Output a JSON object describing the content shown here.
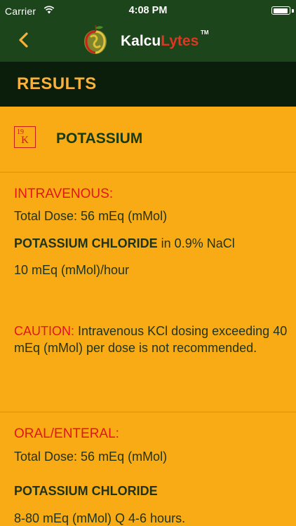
{
  "status_bar": {
    "carrier": "Carrier",
    "time": "4:08 PM"
  },
  "nav": {
    "back_icon": "chevron-left-icon",
    "logo_part1": "Kalcu",
    "logo_part2": "Lytes",
    "logo_tm": "TM"
  },
  "results": {
    "title": "RESULTS"
  },
  "element": {
    "number": "19",
    "symbol": "K",
    "name": "POTASSIUM"
  },
  "intravenous": {
    "heading": "INTRAVENOUS:",
    "total_dose": "Total Dose: 56 mEq (mMol)",
    "drug": "POTASSIUM CHLORIDE",
    "drug_suffix": " in 0.9% NaCl",
    "rate": "10 mEq (mMol)/hour",
    "caution_label": "CAUTION:",
    "caution_text": " Intravenous KCl dosing exceeding 40 mEq (mMol) per dose is not recommended."
  },
  "oral": {
    "heading": "ORAL/ENTERAL:",
    "total_dose": "Total Dose: 56 mEq (mMol)",
    "drug": "POTASSIUM CHLORIDE",
    "dosing": "8-80 mEq (mMol) Q 4-6 hours."
  },
  "colors": {
    "header_green": "#1c451b",
    "results_bar": "#0b1d0b",
    "background": "#f9ab15",
    "accent_red": "#e3141c",
    "title_gold": "#f8b13b"
  }
}
